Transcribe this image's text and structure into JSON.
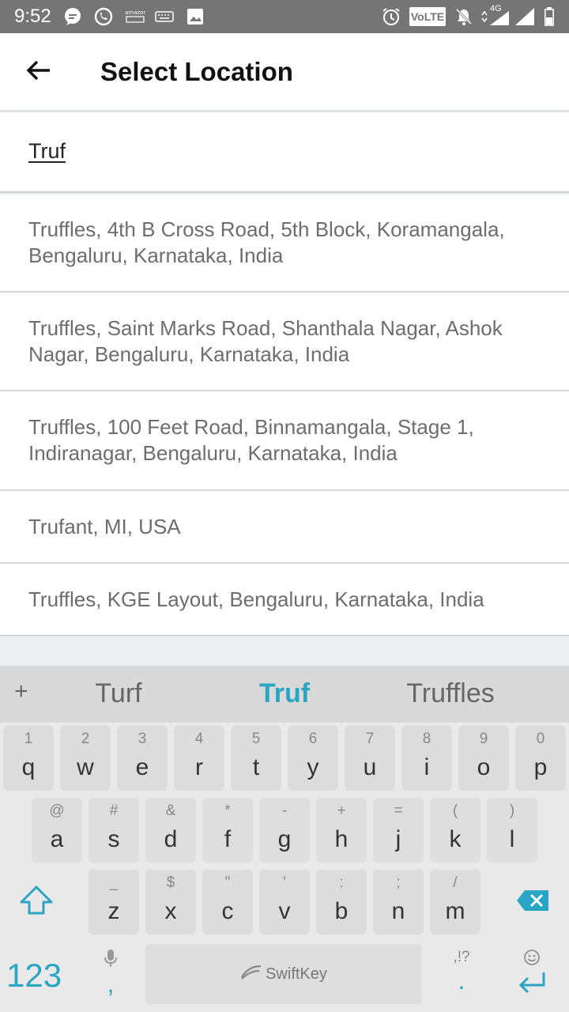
{
  "status_bar": {
    "time": "9:52",
    "volte_label": "VoLTE",
    "network_label": "4G",
    "icons": [
      "message-icon",
      "whatsapp-icon",
      "amazon-icon",
      "keyboard-icon",
      "image-icon",
      "alarm-icon",
      "volte-icon",
      "mute-icon",
      "data-icon",
      "signal-icon",
      "signal-icon",
      "battery-icon"
    ]
  },
  "app_bar": {
    "title": "Select Location",
    "back_icon": "arrow-left-icon"
  },
  "search": {
    "value": "Truf"
  },
  "results": [
    "Truffles, 4th B Cross Road, 5th Block, Koramangala, Bengaluru, Karnataka, India",
    "Truffles, Saint Marks Road, Shanthala Nagar, Ashok Nagar, Bengaluru, Karnataka, India",
    "Truffles, 100 Feet Road, Binnamangala, Stage 1, Indiranagar, Bengaluru, Karnataka, India",
    "Trufant, MI, USA",
    "Truffles, KGE Layout, Bengaluru, Karnataka, India"
  ],
  "keyboard": {
    "plus": "+",
    "suggestions": [
      "Turf",
      "Truf",
      "Truffles"
    ],
    "row1": [
      {
        "hint": "1",
        "key": "q"
      },
      {
        "hint": "2",
        "key": "w"
      },
      {
        "hint": "3",
        "key": "e"
      },
      {
        "hint": "4",
        "key": "r"
      },
      {
        "hint": "5",
        "key": "t"
      },
      {
        "hint": "6",
        "key": "y"
      },
      {
        "hint": "7",
        "key": "u"
      },
      {
        "hint": "8",
        "key": "i"
      },
      {
        "hint": "9",
        "key": "o"
      },
      {
        "hint": "0",
        "key": "p"
      }
    ],
    "row2": [
      {
        "hint": "@",
        "key": "a"
      },
      {
        "hint": "#",
        "key": "s"
      },
      {
        "hint": "&",
        "key": "d"
      },
      {
        "hint": "*",
        "key": "f"
      },
      {
        "hint": "-",
        "key": "g"
      },
      {
        "hint": "+",
        "key": "h"
      },
      {
        "hint": "=",
        "key": "j"
      },
      {
        "hint": "(",
        "key": "k"
      },
      {
        "hint": ")",
        "key": "l"
      }
    ],
    "row3": [
      {
        "hint": "_",
        "key": "z"
      },
      {
        "hint": "$",
        "key": "x"
      },
      {
        "hint": "\"",
        "key": "c"
      },
      {
        "hint": "'",
        "key": "v"
      },
      {
        "hint": ":",
        "key": "b"
      },
      {
        "hint": ";",
        "key": "n"
      },
      {
        "hint": "/",
        "key": "m"
      }
    ],
    "num_label": "123",
    "comma": ",",
    "space_brand": "SwiftKey",
    "punct_hint": ",!?",
    "period": ".",
    "accent_color": "#2aa6c4"
  }
}
